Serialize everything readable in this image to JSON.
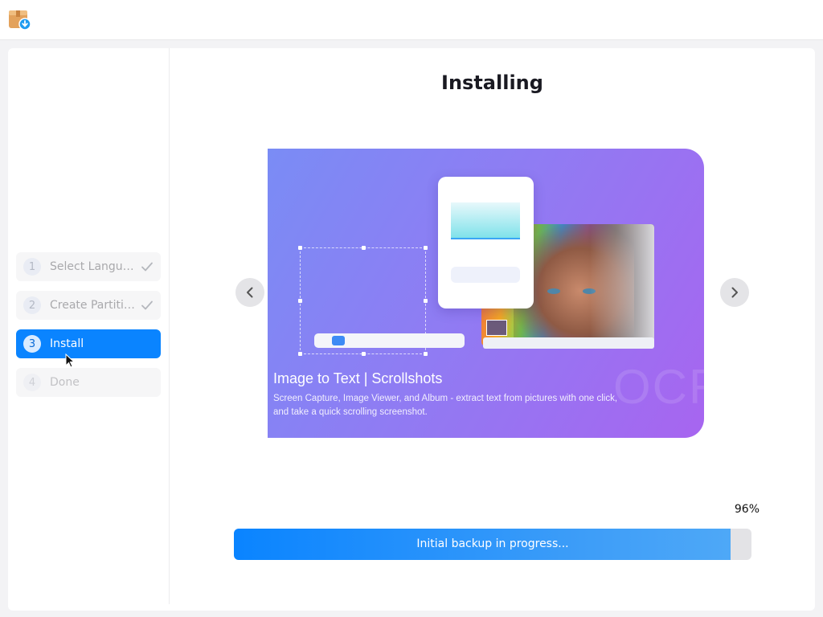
{
  "app": {
    "icon": "installer-package-icon"
  },
  "steps": [
    {
      "number": "1",
      "label": "Select Language",
      "state": "done",
      "icon": "check-icon"
    },
    {
      "number": "2",
      "label": "Create Partitions",
      "state": "done",
      "icon": "check-icon"
    },
    {
      "number": "3",
      "label": "Install",
      "state": "active"
    },
    {
      "number": "4",
      "label": "Done",
      "state": "pending"
    }
  ],
  "main": {
    "title": "Installing",
    "prev_icon": "chevron-left-icon",
    "next_icon": "chevron-right-icon"
  },
  "slide": {
    "heading": "Image to Text | Scrollshots",
    "description": "Screen Capture, Image Viewer, and Album - extract text from pictures with one click, and take a quick scrolling screenshot.",
    "watermark": "OCR"
  },
  "progress": {
    "percent_label": "96%",
    "value": 0.96,
    "status": "Initial backup in progress..."
  },
  "colors": {
    "accent": "#0a84ff",
    "slide_gradient_start": "#7a8cf5",
    "slide_gradient_end": "#a765f0"
  }
}
